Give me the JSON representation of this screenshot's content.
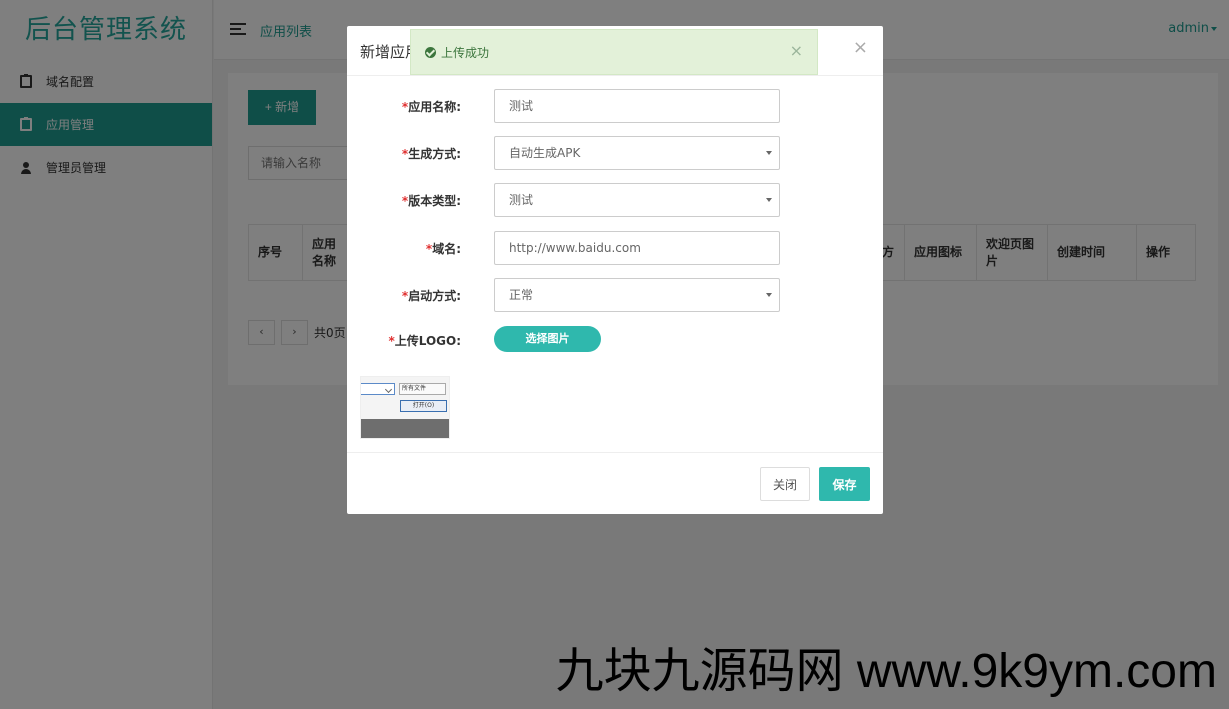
{
  "app": {
    "brand": "后台管理系统",
    "user": "admin"
  },
  "sidebar": {
    "items": [
      {
        "label": "域名配置",
        "icon": "clipboard-icon",
        "active": false
      },
      {
        "label": "应用管理",
        "icon": "clipboard-icon",
        "active": true
      },
      {
        "label": "管理员管理",
        "icon": "user-icon",
        "active": false
      }
    ]
  },
  "topbar": {
    "breadcrumb": "应用列表"
  },
  "main": {
    "add_button": "+ 新增",
    "search_placeholder": "请输入名称",
    "table_headers": [
      "序号",
      "应用名称",
      "方",
      "应用图标",
      "欢迎页图片",
      "创建时间",
      "操作"
    ],
    "pager": {
      "prev": "‹",
      "next": "›",
      "summary": "共0页"
    }
  },
  "modal": {
    "title": "新增应用",
    "fields": [
      {
        "label": "应用名称:",
        "value": "测试",
        "type": "text"
      },
      {
        "label": "生成方式:",
        "value": "自动生成APK",
        "type": "select"
      },
      {
        "label": "版本类型:",
        "value": "测试",
        "type": "select"
      },
      {
        "label": "域名:",
        "value": "http://www.baidu.com",
        "type": "text"
      },
      {
        "label": "启动方式:",
        "value": "正常",
        "type": "select"
      }
    ],
    "logo_label": "上传LOGO:",
    "pick_button": "选择图片",
    "preview": {
      "filter_text": "所有文件",
      "open_text": "打开(O)"
    },
    "close_button": "关闭",
    "save_button": "保存"
  },
  "toast": {
    "message": "上传成功",
    "color": "#3c763d",
    "background": "#e3f1d9"
  },
  "watermark": "九块九源码网 www.9k9ym.com",
  "colors": {
    "accent": "#1e9c91",
    "button": "#2fb8ad",
    "required": "#e03030"
  }
}
